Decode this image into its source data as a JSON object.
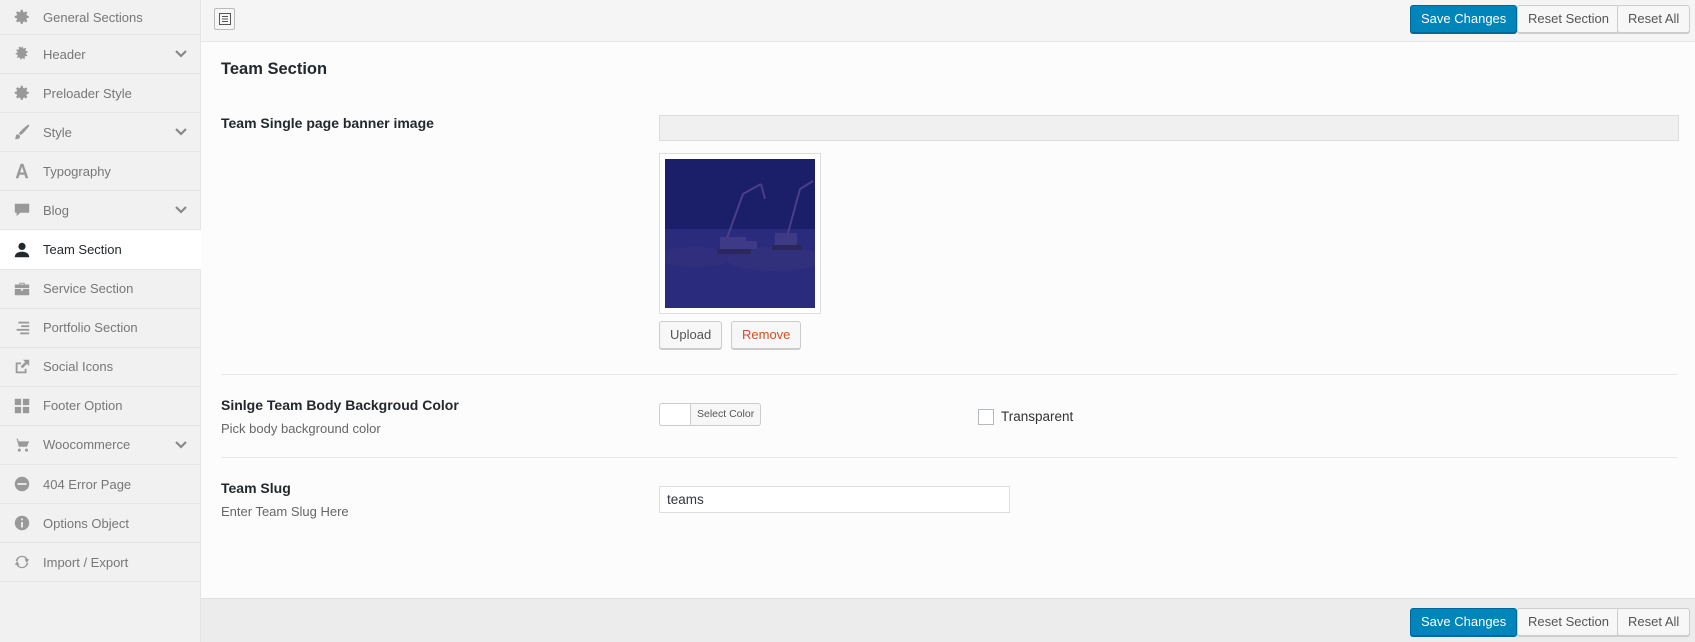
{
  "sidebar": {
    "items": [
      {
        "label": "General Sections",
        "icon": "gear-icon"
      },
      {
        "label": "Header",
        "icon": "cog-burst-icon",
        "expandable": true
      },
      {
        "label": "Preloader Style",
        "icon": "gear-icon"
      },
      {
        "label": "Style",
        "icon": "brush-icon",
        "expandable": true
      },
      {
        "label": "Typography",
        "icon": "typography-icon"
      },
      {
        "label": "Blog",
        "icon": "comment-icon",
        "expandable": true
      },
      {
        "label": "Team Section",
        "icon": "person-icon",
        "active": true
      },
      {
        "label": "Service Section",
        "icon": "briefcase-icon"
      },
      {
        "label": "Portfolio Section",
        "icon": "align-right-icon"
      },
      {
        "label": "Social Icons",
        "icon": "share-icon"
      },
      {
        "label": "Footer Option",
        "icon": "grid-icon"
      },
      {
        "label": "Woocommerce",
        "icon": "cart-icon",
        "expandable": true
      },
      {
        "label": "404 Error Page",
        "icon": "minus-circle-icon"
      },
      {
        "label": "Options Object",
        "icon": "info-icon"
      },
      {
        "label": "Import / Export",
        "icon": "refresh-icon"
      }
    ]
  },
  "toolbar": {
    "save_label": "Save Changes",
    "reset_section_label": "Reset Section",
    "reset_all_label": "Reset All"
  },
  "section": {
    "title": "Team Section",
    "banner": {
      "label": "Team Single page banner image",
      "url_value": "",
      "upload_label": "Upload",
      "remove_label": "Remove"
    },
    "body_color": {
      "label": "Sinlge Team Body Backgroud Color",
      "description": "Pick body background color",
      "select_label": "Select Color",
      "transparent_label": "Transparent"
    },
    "slug": {
      "label": "Team Slug",
      "description": "Enter Team Slug Here",
      "value": "teams"
    }
  },
  "colors": {
    "primary": "#0085ba",
    "remove_text": "#d54e21"
  }
}
